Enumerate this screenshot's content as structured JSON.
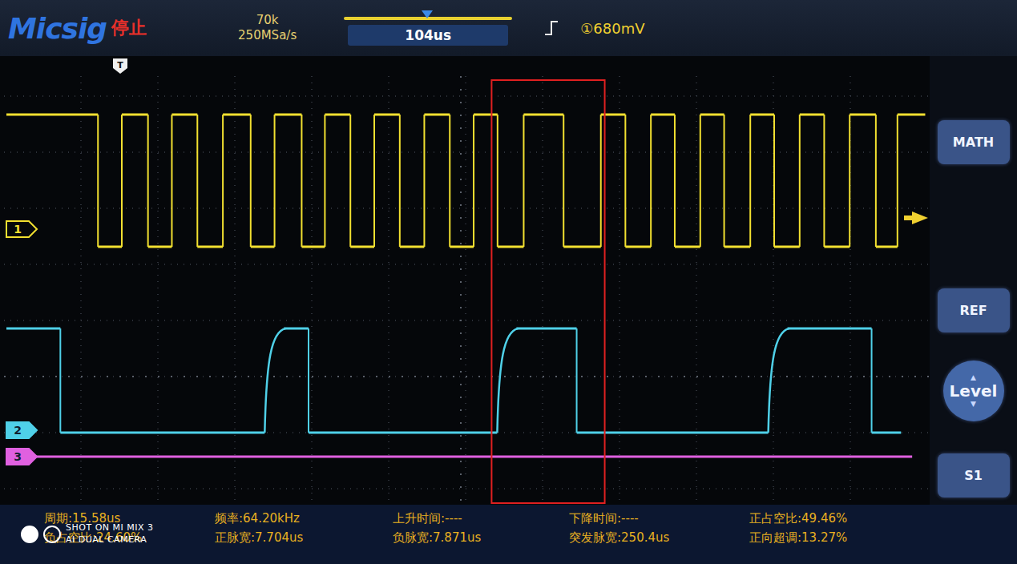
{
  "header": {
    "brand": "Micsig",
    "run_state": "停止",
    "memory": "70k",
    "sample_rate": "250MSa/s",
    "timebase": "104us",
    "trigger_slope": "rising",
    "trigger_level": "①680mV"
  },
  "trigger_marker": "T",
  "side_buttons": [
    {
      "label": "MATH",
      "kind": "rect"
    },
    {
      "label": "REF",
      "kind": "rect"
    },
    {
      "label": "Level",
      "kind": "round"
    },
    {
      "label": "S1",
      "kind": "rect"
    }
  ],
  "chart": {
    "series": [
      {
        "name": "1",
        "color": "#f2e030",
        "slow_rise": false,
        "levels": [
          1,
          0,
          1,
          0,
          1,
          0,
          1,
          0,
          1,
          0,
          1,
          0,
          1,
          0,
          1,
          0,
          1,
          0,
          1,
          0,
          1,
          0,
          1,
          0,
          1,
          0,
          1,
          0,
          1,
          0,
          1,
          0,
          1
        ],
        "durations_us": [
          28.0,
          7.3,
          8.0,
          7.3,
          7.8,
          7.8,
          8.5,
          7.3,
          8.3,
          7.1,
          7.8,
          7.3,
          7.8,
          7.5,
          7.8,
          7.3,
          7.3,
          8.0,
          12.2,
          11.4,
          7.5,
          7.8,
          7.3,
          7.8,
          7.3,
          8.0,
          7.3,
          7.8,
          7.5,
          7.8,
          8.0,
          6.6,
          8.5
        ]
      },
      {
        "name": "2",
        "color": "#4fd0e8",
        "slow_rise": true,
        "levels": [
          1,
          0,
          1,
          0,
          1,
          0,
          1,
          0
        ],
        "durations_us": [
          16.5,
          62.5,
          13.4,
          57.7,
          24.3,
          58.6,
          31.6,
          9.0
        ]
      },
      {
        "name": "3",
        "color": "#e060e0",
        "slow_rise": false,
        "levels": [
          0
        ],
        "durations_us": [
          277.0
        ]
      }
    ],
    "highlight": {
      "series": "2",
      "segment": 4,
      "color": "#e02020"
    }
  },
  "measurements": [
    [
      "周期:15.58us",
      "频率:64.20kHz",
      "上升时间:----",
      "下降时间:----",
      "正占空比:49.46%"
    ],
    [
      "负占空比:24.60%",
      "正脉宽:7.704us",
      "负脉宽:7.871us",
      "突发脉宽:250.4us",
      "正向超调:13.27%"
    ]
  ],
  "watermark": {
    "line1": "SHOT ON MI MIX 3",
    "line2": "AI DUAL CAMERA"
  }
}
